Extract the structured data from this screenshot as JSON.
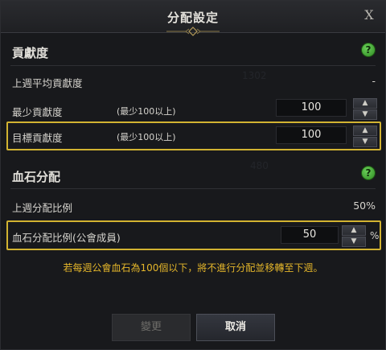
{
  "dialog": {
    "title": "分配設定",
    "close_label": "X"
  },
  "contribution": {
    "section_title": "貢獻度",
    "help_label": "?",
    "last_week_avg_label": "上週平均貢獻度",
    "last_week_avg_value": "-",
    "min_label": "最少貢獻度",
    "min_hint": "(最少100以上)",
    "min_value": "100",
    "target_label": "目標貢獻度",
    "target_hint": "(最少100以上)",
    "target_value": "100"
  },
  "distribution": {
    "section_title": "血石分配",
    "help_label": "?",
    "last_week_ratio_label": "上週分配比例",
    "last_week_ratio_value": "50%",
    "ratio_label": "血石分配比例(公會成員)",
    "ratio_value": "50",
    "ratio_unit": "%"
  },
  "notice": "若每週公會血石為100個以下，將不進行分配並移轉至下週。",
  "buttons": {
    "change": "變更",
    "cancel": "取消"
  },
  "icons": {
    "up": "chevron-up-icon",
    "down": "chevron-down-icon",
    "help": "help-icon"
  },
  "colors": {
    "highlight": "#d2b331",
    "notice": "#e3b52a",
    "help_green": "#3fa52e"
  }
}
